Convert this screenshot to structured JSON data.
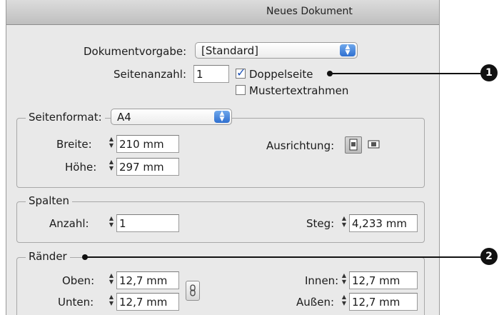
{
  "window": {
    "title": "Neues Dokument"
  },
  "top": {
    "preset_label": "Dokumentvorgabe:",
    "preset_value": "[Standard]",
    "pages_label": "Seitenanzahl:",
    "pages_value": "1",
    "facing_pages_label": "Doppelseite",
    "facing_pages_checked": true,
    "master_frame_label": "Mustertextrahmen",
    "master_frame_checked": false
  },
  "page_size": {
    "legend": "Seitenformat:",
    "format_value": "A4",
    "width_label": "Breite:",
    "width_value": "210 mm",
    "height_label": "Höhe:",
    "height_value": "297 mm",
    "orientation_label": "Ausrichtung:",
    "orientation_selected": "portrait"
  },
  "columns": {
    "legend": "Spalten",
    "count_label": "Anzahl:",
    "count_value": "1",
    "gutter_label": "Steg:",
    "gutter_value": "4,233 mm"
  },
  "margins": {
    "legend": "Ränder",
    "top_label": "Oben:",
    "top_value": "12,7 mm",
    "bottom_label": "Unten:",
    "bottom_value": "12,7 mm",
    "inside_label": "Innen:",
    "inside_value": "12,7 mm",
    "outside_label": "Außen:",
    "outside_value": "12,7 mm"
  },
  "callouts": [
    "1",
    "2"
  ],
  "colors": {
    "accent": "#2f6fd0",
    "callout": "#111111"
  }
}
